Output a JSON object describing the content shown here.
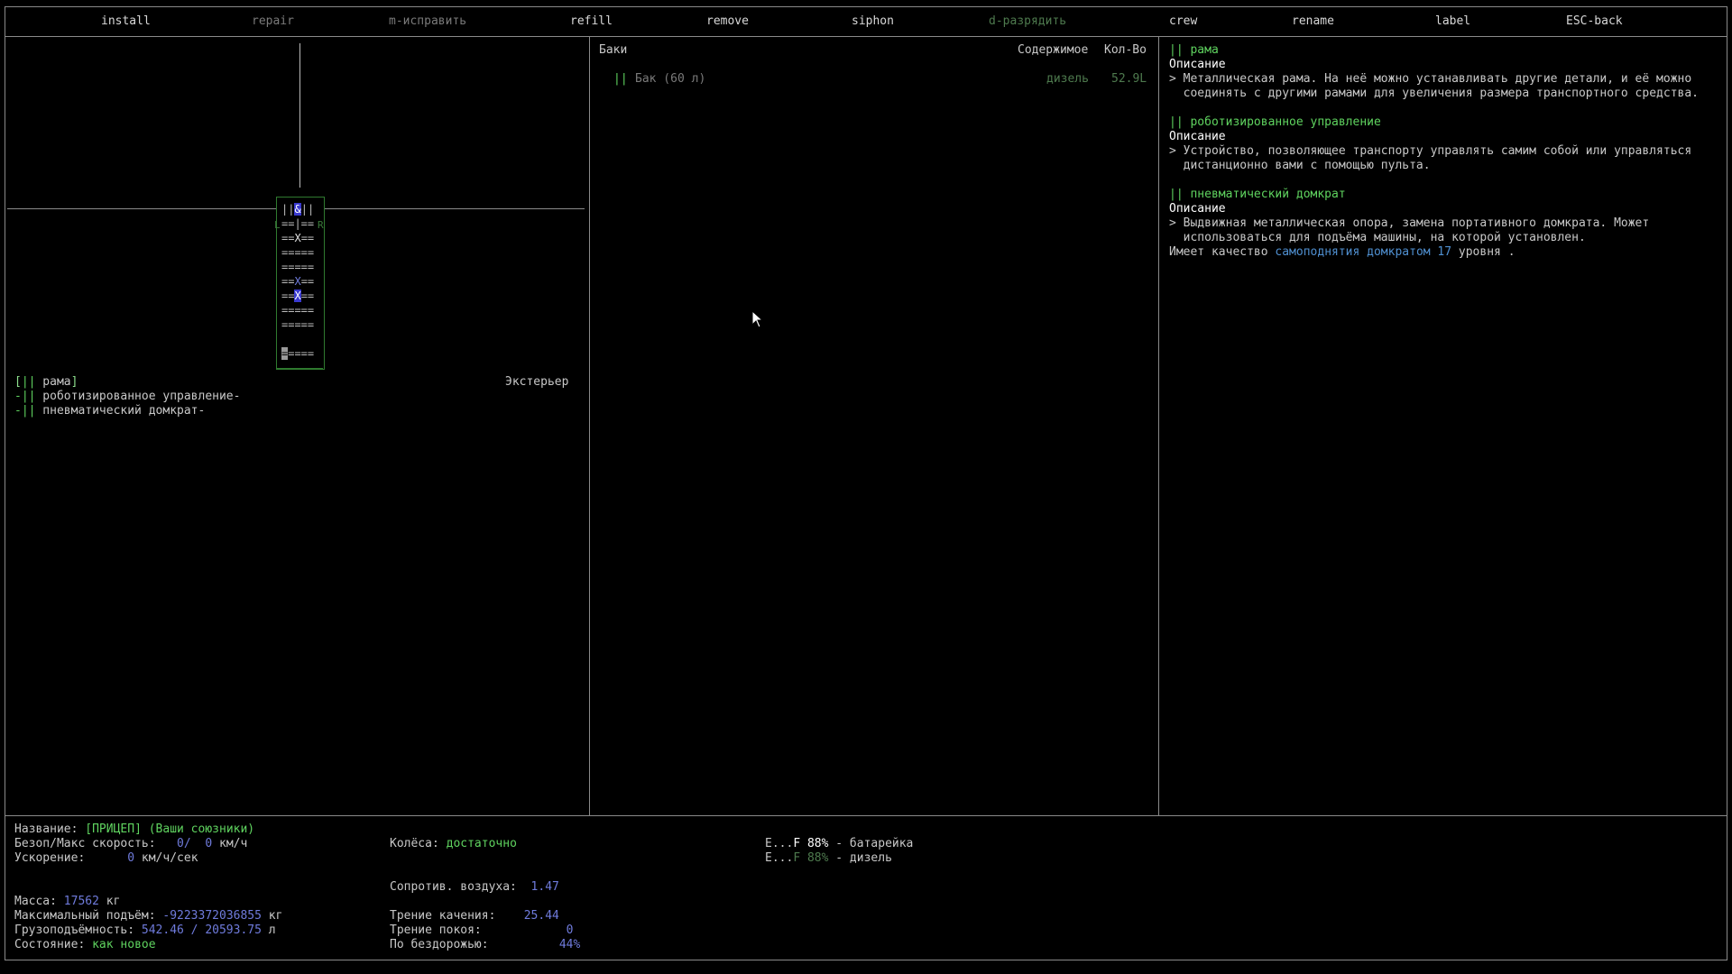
{
  "menu": {
    "install": "install",
    "repair": "repair",
    "fix": "m-исправить",
    "refill": "refill",
    "remove": "remove",
    "siphon": "siphon",
    "discharge": "d-разрядить",
    "crew": "crew",
    "rename": "rename",
    "label": "label",
    "back": "ESC-back"
  },
  "vehicle_view": {
    "grid_rows": [
      "|&||",
      "==|==",
      "==X==",
      "=====",
      "=====",
      "==X==",
      "==X==",
      "=====",
      "=====",
      "====="
    ],
    "side_left": "L",
    "side_right": "R"
  },
  "parts_list": {
    "items": [
      "[|| рама]",
      "-|| роботизированное управление-",
      "-|| пневматический домкрат-"
    ],
    "exterior_label": "Экстерьер"
  },
  "tanks": {
    "header": "Баки",
    "col_contents": "Содержимое",
    "col_amount": "Кол-Во",
    "rows": [
      {
        "marker": "||",
        "name": "Бак (60 л)",
        "contents": "дизель",
        "amount": "52.9L"
      }
    ]
  },
  "descriptions": [
    {
      "title": "|| рама",
      "label": "Описание",
      "lines": [
        "> Металлическая рама. На неё можно устанавливать другие детали, и её можно",
        "  соединять с другими рамами для увеличения размера транспортного средства."
      ]
    },
    {
      "title": "|| роботизированное управление",
      "label": "Описание",
      "lines": [
        "> Устройство, позволяющее транспорту управлять самим собой или управляться",
        "  дистанционно вами с помощью пульта."
      ]
    },
    {
      "title": "|| пневматический домкрат",
      "label": "Описание",
      "lines": [
        "> Выдвижная металлическая опора, замена портативного домкрата. Может",
        "  использоваться для подъёма машины, на которой установлен."
      ],
      "quality_prefix": "Имеет качество ",
      "quality_value": "самоподнятия домкратом 17",
      "quality_suffix": " уровня ."
    }
  ],
  "stats": {
    "name_label": "Название:",
    "name_value": "[ПРИЦЕП] (Ваши союзники)",
    "speed_label": "Безоп/Макс скорость:",
    "speed_safe": "0/",
    "speed_max": "0",
    "speed_unit": "км/ч",
    "accel_label": "Ускорение:",
    "accel_value": "0",
    "accel_unit": "км/ч/сек",
    "mass_label": "Масса:",
    "mass_value": "17562",
    "mass_unit": "кг",
    "lift_label": "Максимальный подъём:",
    "lift_value": "-9223372036855",
    "lift_unit": "кг",
    "cargo_label": "Грузоподъёмность:",
    "cargo_value": "542.46 / 20593.75",
    "cargo_unit": "л",
    "status_label": "Состояние:",
    "status_value": "как новое",
    "wheels_label": "Колёса:",
    "wheels_value": "достаточно",
    "air_label": "Сопротив. воздуха:",
    "air_value": "1.47",
    "rolling_label": "Трение качения:",
    "rolling_value": "25.44",
    "static_label": "Трение покоя:",
    "static_value": "0",
    "offroad_label": "По бездорожью:",
    "offroad_value": "44%",
    "fuel": [
      {
        "gauge_e": "E...",
        "gauge_f": "F",
        "percent": "88%",
        "name": "- батарейка"
      },
      {
        "gauge_e": "E...",
        "gauge_f": "F",
        "percent": "88%",
        "name": "- дизель"
      }
    ]
  }
}
